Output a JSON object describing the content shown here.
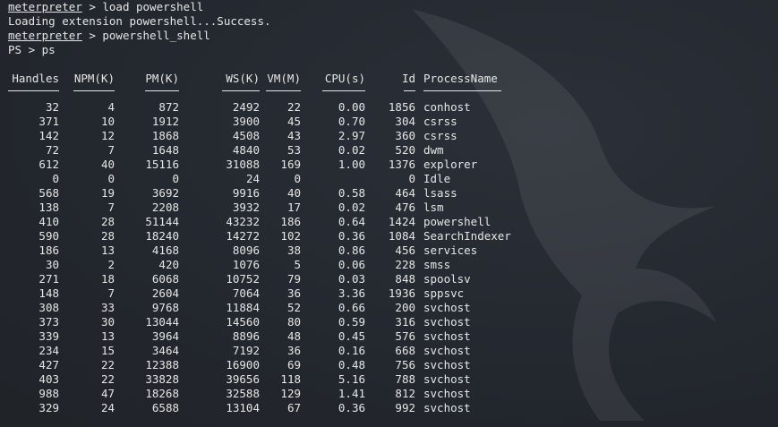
{
  "terminal": {
    "lines": [
      {
        "prompt": "meterpreter",
        "rest": " > load powershell"
      },
      {
        "text": "Loading extension powershell...Success."
      },
      {
        "prompt": "meterpreter",
        "rest": " > powershell_shell"
      },
      {
        "text": "PS > ps"
      }
    ]
  },
  "table": {
    "headers": {
      "handles": "Handles",
      "npm": "NPM(K)",
      "pm": "PM(K)",
      "ws": "WS(K)",
      "vm": "VM(M)",
      "cpu": "CPU(s)",
      "id": "Id",
      "name": "ProcessName"
    },
    "rows": [
      {
        "handles": "32",
        "npm": "4",
        "pm": "872",
        "ws": "2492",
        "vm": "22",
        "cpu": "0.00",
        "id": "1856",
        "name": "conhost"
      },
      {
        "handles": "371",
        "npm": "10",
        "pm": "1912",
        "ws": "3900",
        "vm": "45",
        "cpu": "0.70",
        "id": "304",
        "name": "csrss"
      },
      {
        "handles": "142",
        "npm": "12",
        "pm": "1868",
        "ws": "4508",
        "vm": "43",
        "cpu": "2.97",
        "id": "360",
        "name": "csrss"
      },
      {
        "handles": "72",
        "npm": "7",
        "pm": "1648",
        "ws": "4840",
        "vm": "53",
        "cpu": "0.02",
        "id": "520",
        "name": "dwm"
      },
      {
        "handles": "612",
        "npm": "40",
        "pm": "15116",
        "ws": "31088",
        "vm": "169",
        "cpu": "1.00",
        "id": "1376",
        "name": "explorer"
      },
      {
        "handles": "0",
        "npm": "0",
        "pm": "0",
        "ws": "24",
        "vm": "0",
        "cpu": "",
        "id": "0",
        "name": "Idle"
      },
      {
        "handles": "568",
        "npm": "19",
        "pm": "3692",
        "ws": "9916",
        "vm": "40",
        "cpu": "0.58",
        "id": "464",
        "name": "lsass"
      },
      {
        "handles": "138",
        "npm": "7",
        "pm": "2208",
        "ws": "3932",
        "vm": "17",
        "cpu": "0.02",
        "id": "476",
        "name": "lsm"
      },
      {
        "handles": "410",
        "npm": "28",
        "pm": "51144",
        "ws": "43232",
        "vm": "186",
        "cpu": "0.64",
        "id": "1424",
        "name": "powershell"
      },
      {
        "handles": "590",
        "npm": "28",
        "pm": "18240",
        "ws": "14272",
        "vm": "102",
        "cpu": "0.36",
        "id": "1084",
        "name": "SearchIndexer"
      },
      {
        "handles": "186",
        "npm": "13",
        "pm": "4168",
        "ws": "8096",
        "vm": "38",
        "cpu": "0.86",
        "id": "456",
        "name": "services"
      },
      {
        "handles": "30",
        "npm": "2",
        "pm": "420",
        "ws": "1076",
        "vm": "5",
        "cpu": "0.06",
        "id": "228",
        "name": "smss"
      },
      {
        "handles": "271",
        "npm": "18",
        "pm": "6068",
        "ws": "10752",
        "vm": "79",
        "cpu": "0.03",
        "id": "848",
        "name": "spoolsv"
      },
      {
        "handles": "148",
        "npm": "7",
        "pm": "2604",
        "ws": "7064",
        "vm": "36",
        "cpu": "3.36",
        "id": "1936",
        "name": "sppsvc"
      },
      {
        "handles": "308",
        "npm": "33",
        "pm": "9768",
        "ws": "11884",
        "vm": "52",
        "cpu": "0.66",
        "id": "200",
        "name": "svchost"
      },
      {
        "handles": "373",
        "npm": "30",
        "pm": "13044",
        "ws": "14560",
        "vm": "80",
        "cpu": "0.59",
        "id": "316",
        "name": "svchost"
      },
      {
        "handles": "339",
        "npm": "13",
        "pm": "3964",
        "ws": "8896",
        "vm": "48",
        "cpu": "0.45",
        "id": "576",
        "name": "svchost"
      },
      {
        "handles": "234",
        "npm": "15",
        "pm": "3464",
        "ws": "7192",
        "vm": "36",
        "cpu": "0.16",
        "id": "668",
        "name": "svchost"
      },
      {
        "handles": "427",
        "npm": "22",
        "pm": "12388",
        "ws": "16900",
        "vm": "69",
        "cpu": "0.48",
        "id": "756",
        "name": "svchost"
      },
      {
        "handles": "403",
        "npm": "22",
        "pm": "33828",
        "ws": "39656",
        "vm": "118",
        "cpu": "5.16",
        "id": "788",
        "name": "svchost"
      },
      {
        "handles": "988",
        "npm": "47",
        "pm": "18268",
        "ws": "32588",
        "vm": "129",
        "cpu": "1.41",
        "id": "812",
        "name": "svchost"
      },
      {
        "handles": "329",
        "npm": "24",
        "pm": "6588",
        "ws": "13104",
        "vm": "67",
        "cpu": "0.36",
        "id": "992",
        "name": "svchost"
      }
    ]
  },
  "colors": {
    "background": "#23272e",
    "text": "#e6e6e6"
  }
}
